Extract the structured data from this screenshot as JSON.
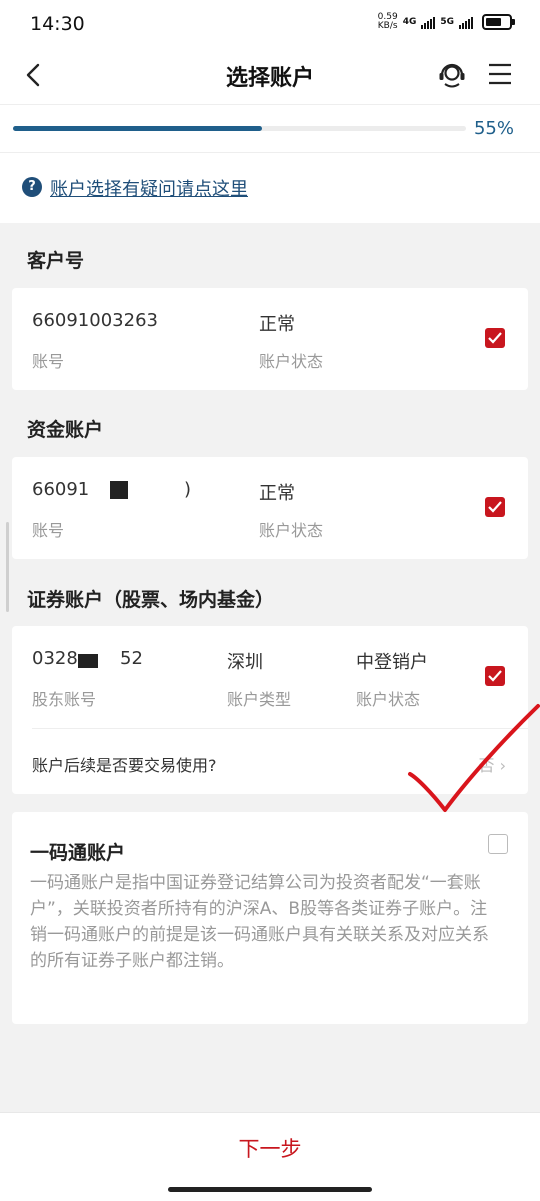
{
  "status_bar": {
    "time": "14:30",
    "speed_value": "0.59",
    "speed_unit": "KB/s",
    "net1": "4G",
    "net2": "5G"
  },
  "nav": {
    "title": "选择账户"
  },
  "progress": {
    "value": 0.55,
    "label": "55%"
  },
  "help": {
    "icon_text": "?",
    "link_text": "账户选择有疑问请点这里"
  },
  "customer": {
    "section_title": "客户号",
    "account_no": "66091003263",
    "account_no_label": "账号",
    "status": "正常",
    "status_label": "账户状态",
    "checked": true
  },
  "fund": {
    "section_title": "资金账户",
    "account_no_prefix": "66091",
    "account_no_suffix": ")",
    "account_no_label": "账号",
    "status": "正常",
    "status_label": "账户状态",
    "checked": true
  },
  "securities": {
    "section_title": "证券账户（股票、场内基金）",
    "account_no_prefix": "0328",
    "account_no_suffix": "52",
    "account_no_label": "股东账号",
    "market": "深圳",
    "market_label": "账户类型",
    "status": "中登销户",
    "status_label": "账户状态",
    "checked": true,
    "question": "账户后续是否要交易使用?",
    "answer": "否"
  },
  "ymt": {
    "title": "一码通账户",
    "description": "一码通账户是指中国证券登记结算公司为投资者配发“一套账户”，关联投资者所持有的沪深A、B股等各类证券子账户。注销一码通账户的前提是该一码通账户具有关联关系及对应关系的所有证券子账户都注销。",
    "checked": false
  },
  "footer": {
    "next_label": "下一步"
  },
  "colors": {
    "accent": "#c8161e",
    "primary": "#1f5f8b",
    "link": "#1f4e79"
  }
}
